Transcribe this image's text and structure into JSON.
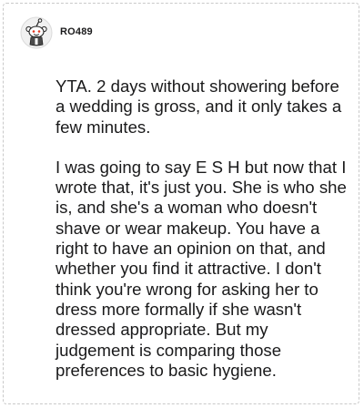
{
  "comment": {
    "username": "RO489",
    "avatar_icon": "snoo-avatar-icon",
    "paragraphs": [
      "YTA. 2 days without showering before a wedding is gross, and it only takes a few minutes.",
      "I was going to say E S H but now that I wrote that, it's just you. She is who she is, and she's a woman who doesn't shave or wear makeup. You have a right to have an opinion on that, and whether you find it attractive. I don't think you're wrong for asking her to dress more formally if she wasn't dressed appropriate. But my judgement is comparing those preferences to basic hygiene."
    ]
  }
}
